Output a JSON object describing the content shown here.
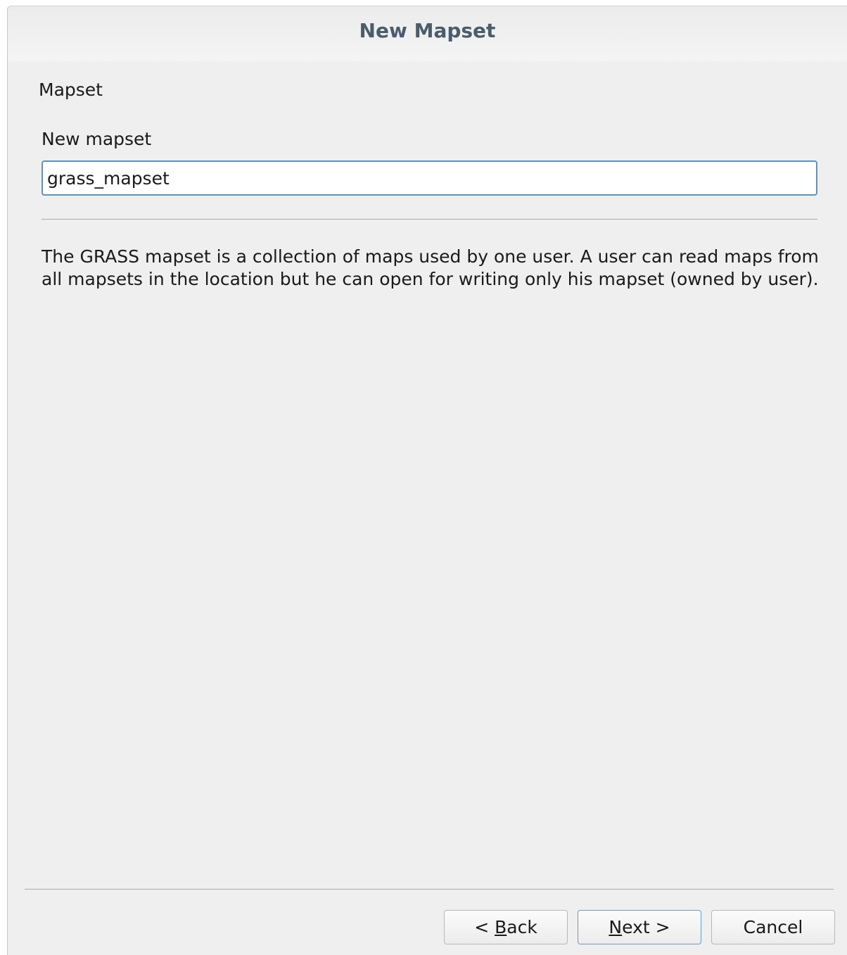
{
  "window": {
    "title": "New Mapset"
  },
  "page": {
    "heading": "Mapset",
    "field_label": "New mapset",
    "mapset_input_value": "grass_mapset",
    "description": "The GRASS mapset is a collection of maps used by one user. A user can read maps from all mapsets in the location but he can open for writing only his mapset (owned by user)."
  },
  "buttons": {
    "back": {
      "prefix": "< ",
      "mnemonic": "B",
      "rest": "ack"
    },
    "next": {
      "mnemonic": "N",
      "rest": "ext >"
    },
    "cancel": "Cancel"
  }
}
